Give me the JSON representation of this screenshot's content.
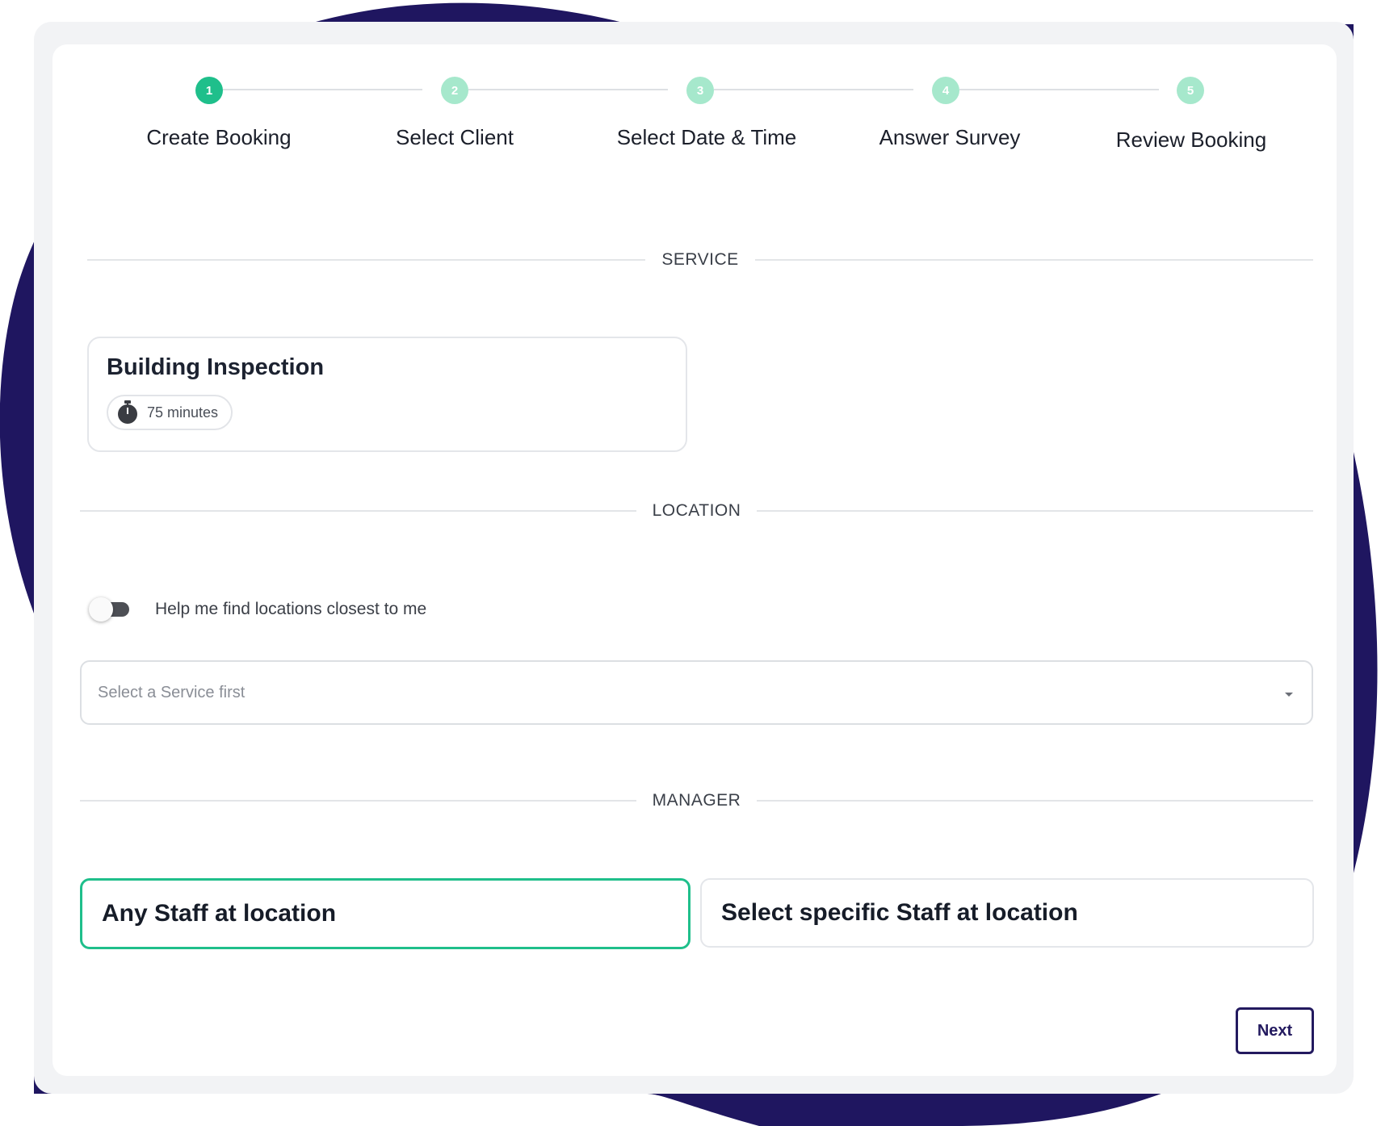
{
  "stepper": {
    "steps": [
      {
        "number": "1",
        "label": "Create Booking"
      },
      {
        "number": "2",
        "label": "Select Client"
      },
      {
        "number": "3",
        "label": "Select Date & Time"
      },
      {
        "number": "4",
        "label": "Answer Survey"
      },
      {
        "number": "5",
        "label": "Review Booking"
      }
    ],
    "active_step": 1
  },
  "service": {
    "section_title": "SERVICE",
    "card": {
      "name": "Building Inspection",
      "duration": "75 minutes",
      "duration_icon": "stopwatch-icon"
    }
  },
  "location": {
    "section_title": "LOCATION",
    "toggle_label": "Help me find locations closest to me",
    "toggle_on": false,
    "select_placeholder": "Select a Service first"
  },
  "manager": {
    "section_title": "MANAGER",
    "options": [
      {
        "label": "Any Staff at location",
        "selected": true
      },
      {
        "label": "Select specific Staff at location",
        "selected": false
      }
    ]
  },
  "actions": {
    "next_label": "Next"
  },
  "colors": {
    "accent": "#1fbf8b",
    "accent_light": "#a6e8cc",
    "brand_dark": "#231a5f",
    "background_blob": "#1f1660"
  }
}
